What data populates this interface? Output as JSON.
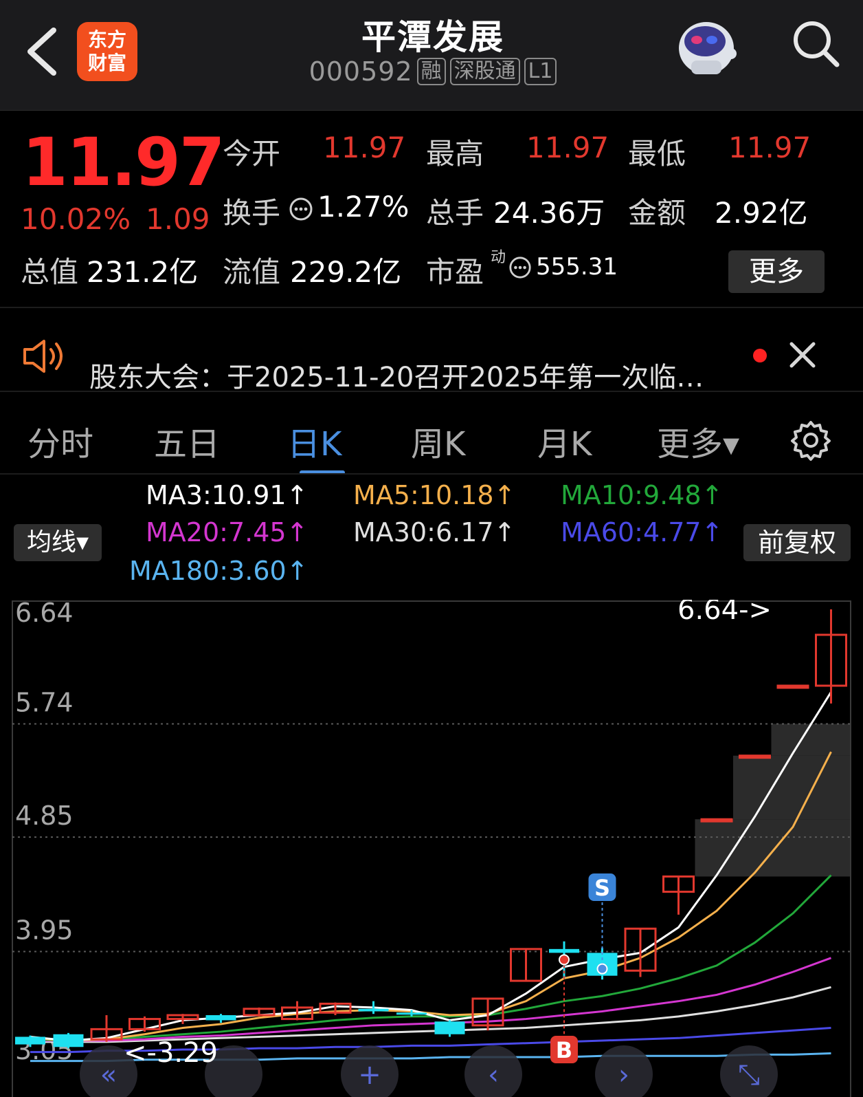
{
  "header": {
    "logo_line1": "东方",
    "logo_line2": "财富",
    "title": "平潭发展",
    "code": "000592",
    "tags": [
      "融",
      "深股通",
      "L1"
    ]
  },
  "quote": {
    "price": "11.97",
    "change_pct": "10.02%",
    "change": "1.09",
    "open_label": "今开",
    "open": "11.97",
    "high_label": "最高",
    "high": "11.97",
    "low_label": "最低",
    "low": "11.97",
    "turnover_label": "换手",
    "turnover": "1.27%",
    "volume_label": "总手",
    "volume": "24.36万",
    "amount_label": "金额",
    "amount": "2.92亿",
    "mktcap_label": "总值",
    "mktcap": "231.2亿",
    "float_label": "流值",
    "float": "229.2亿",
    "pe_label": "市盈",
    "pe_sup": "动",
    "pe": "555.31",
    "more": "更多"
  },
  "notice": {
    "text": "股东大会：于2025-11-20召开2025年第一次临…"
  },
  "tabs": [
    "分时",
    "五日",
    "日K",
    "周K",
    "月K",
    "更多▾"
  ],
  "indicators": {
    "avg_button": "均线▾",
    "adjust_button": "前复权",
    "ma3": "MA3:10.91↑",
    "ma5": "MA5:10.18↑",
    "ma10": "MA10:9.48↑",
    "ma20": "MA20:7.45↑",
    "ma30": "MA30:6.17↑",
    "ma60": "MA60:4.77↑",
    "ma180": "MA180:3.60↑"
  },
  "colors": {
    "up": "#e2382e",
    "down": "#1ee0f0",
    "ma3": "#ffffff",
    "ma5": "#f5b04c",
    "ma10": "#22a83a",
    "ma20": "#d436d0",
    "ma30": "#e0e0e0",
    "ma60": "#4a4ae8",
    "ma180": "#5ab4f0"
  },
  "chart_data": {
    "type": "candlestick",
    "y_ticks": [
      "6.64",
      "5.74",
      "4.85",
      "3.95",
      "3.05"
    ],
    "ylim": [
      3.05,
      6.64
    ],
    "max_label": "6.64->",
    "min_label": "<-3.29",
    "candles": [
      {
        "o": 3.28,
        "c": 3.22,
        "h": 3.29,
        "l": 3.2
      },
      {
        "o": 3.3,
        "c": 3.2,
        "h": 3.31,
        "l": 3.19
      },
      {
        "o": 3.26,
        "c": 3.34,
        "h": 3.45,
        "l": 3.24
      },
      {
        "o": 3.34,
        "c": 3.42,
        "h": 3.44,
        "l": 3.32
      },
      {
        "o": 3.42,
        "c": 3.45,
        "h": 3.46,
        "l": 3.38
      },
      {
        "o": 3.45,
        "c": 3.41,
        "h": 3.46,
        "l": 3.39
      },
      {
        "o": 3.45,
        "c": 3.5,
        "h": 3.51,
        "l": 3.44
      },
      {
        "o": 3.42,
        "c": 3.51,
        "h": 3.56,
        "l": 3.41
      },
      {
        "o": 3.47,
        "c": 3.54,
        "h": 3.55,
        "l": 3.45
      },
      {
        "o": 3.5,
        "c": 3.48,
        "h": 3.56,
        "l": 3.46
      },
      {
        "o": 3.47,
        "c": 3.46,
        "h": 3.49,
        "l": 3.44
      },
      {
        "o": 3.4,
        "c": 3.3,
        "h": 3.41,
        "l": 3.28
      },
      {
        "o": 3.37,
        "c": 3.58,
        "h": 3.58,
        "l": 3.33
      },
      {
        "o": 3.72,
        "c": 3.97,
        "h": 3.97,
        "l": 3.72
      },
      {
        "o": 3.97,
        "c": 3.94,
        "h": 4.03,
        "l": 3.74
      },
      {
        "o": 3.94,
        "c": 3.76,
        "h": 3.98,
        "l": 3.73
      },
      {
        "o": 3.8,
        "c": 4.13,
        "h": 4.13,
        "l": 3.75
      },
      {
        "o": 4.42,
        "c": 4.54,
        "h": 4.54,
        "l": 4.24
      },
      {
        "o": 4.99,
        "c": 4.99,
        "h": 4.99,
        "l": 4.99
      },
      {
        "o": 5.49,
        "c": 5.49,
        "h": 5.49,
        "l": 5.49
      },
      {
        "o": 6.04,
        "c": 6.04,
        "h": 6.04,
        "l": 6.04
      },
      {
        "o": 6.04,
        "c": 6.44,
        "h": 6.64,
        "l": 5.9
      }
    ],
    "ma_lines": {
      "ma3": [
        3.28,
        3.25,
        3.27,
        3.34,
        3.41,
        3.43,
        3.45,
        3.47,
        3.52,
        3.51,
        3.49,
        3.41,
        3.45,
        3.62,
        3.83,
        3.89,
        3.94,
        4.14,
        4.55,
        5.01,
        5.51,
        5.99
      ],
      "ma5": [
        3.27,
        3.25,
        3.26,
        3.3,
        3.35,
        3.38,
        3.43,
        3.46,
        3.48,
        3.49,
        3.48,
        3.45,
        3.46,
        3.56,
        3.74,
        3.8,
        3.9,
        4.06,
        4.27,
        4.57,
        4.93,
        5.52
      ],
      "ma10": [
        3.26,
        3.25,
        3.26,
        3.28,
        3.3,
        3.32,
        3.35,
        3.38,
        3.41,
        3.43,
        3.44,
        3.44,
        3.45,
        3.5,
        3.56,
        3.6,
        3.66,
        3.74,
        3.84,
        4.02,
        4.25,
        4.55
      ],
      "ma20": [
        3.25,
        3.25,
        3.25,
        3.26,
        3.28,
        3.29,
        3.31,
        3.33,
        3.35,
        3.37,
        3.38,
        3.39,
        3.4,
        3.42,
        3.45,
        3.48,
        3.52,
        3.56,
        3.61,
        3.69,
        3.79,
        3.9
      ],
      "ma30": [
        3.24,
        3.24,
        3.24,
        3.25,
        3.26,
        3.27,
        3.28,
        3.29,
        3.3,
        3.31,
        3.32,
        3.33,
        3.34,
        3.35,
        3.37,
        3.39,
        3.41,
        3.44,
        3.48,
        3.53,
        3.59,
        3.67
      ],
      "ma60": [
        3.16,
        3.16,
        3.17,
        3.17,
        3.18,
        3.18,
        3.19,
        3.19,
        3.2,
        3.2,
        3.21,
        3.21,
        3.22,
        3.23,
        3.24,
        3.25,
        3.26,
        3.27,
        3.29,
        3.31,
        3.33,
        3.35
      ],
      "ma180": [
        3.09,
        3.09,
        3.09,
        3.1,
        3.1,
        3.1,
        3.1,
        3.11,
        3.11,
        3.11,
        3.11,
        3.12,
        3.12,
        3.12,
        3.12,
        3.13,
        3.13,
        3.13,
        3.13,
        3.14,
        3.14,
        3.15
      ]
    },
    "markers": {
      "sell_label": "S",
      "buy_label": "B",
      "sell_index": 15,
      "buy_index": 14
    },
    "gaps": [
      {
        "from_index": 17,
        "low": 4.54,
        "high": 4.99
      },
      {
        "from_index": 18,
        "low": 4.99,
        "high": 5.49
      },
      {
        "from_index": 19,
        "low": 5.49,
        "high": 5.74
      }
    ],
    "grid": true,
    "controls": [
      "«",
      "+",
      "‹",
      "›",
      "⤡"
    ]
  }
}
